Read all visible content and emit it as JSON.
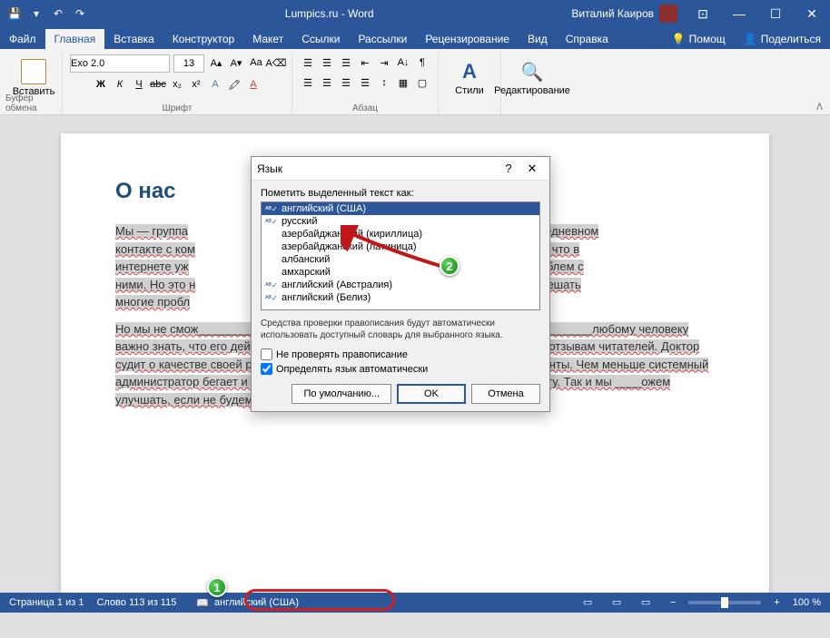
{
  "app": {
    "title": "Lumpics.ru - Word",
    "user": "Виталий Каиров"
  },
  "tabs": {
    "file": "Файл",
    "home": "Главная",
    "insert": "Вставка",
    "design": "Конструктор",
    "layout": "Макет",
    "references": "Ссылки",
    "mailings": "Рассылки",
    "review": "Рецензирование",
    "view": "Вид",
    "help": "Справка",
    "tell_me": "Помощ",
    "share": "Поделиться"
  },
  "ribbon": {
    "paste": "Вставить",
    "clipboard_group": "Буфер обмена",
    "font_name": "Exo 2.0",
    "font_size": "13",
    "font_group": "Шрифт",
    "paragraph_group": "Абзац",
    "styles": "Стили",
    "editing": "Редактирование"
  },
  "document": {
    "heading": "О нас",
    "p1a": "Мы — группа",
    "p1b": "м в ежедневном",
    "p2a": "контакте с ком",
    "p2b": "Мы знаем, что в",
    "p3a": "интернете уж",
    "p3b": "да проблем с",
    "p4a": "ними. Но это н",
    "p4b": "Вам, как решать",
    "p5": "многие пробл",
    "p6": "Но мы не смож____________________________________________________________любому человеку важно знать, что его действия правильные. Писатель судит о своей работе по отзывам читателей. Доктор судит о качестве своей работы по тому, как быстро выздоравливают его пациенты. Чем меньше системный администратор бегает и что-то настраивает, тем он качественнее делает работу. Так и мы ____ожем улучшать, если не будем получать ответов от Вас."
  },
  "dialog": {
    "title": "Язык",
    "label": "Пометить выделенный текст как:",
    "items": [
      "английский (США)",
      "русский",
      "азербайджанский (кириллица)",
      "азербайджанский (латиница)",
      "албанский",
      "амхарский",
      "английский (Австралия)",
      "английский (Белиз)"
    ],
    "info": "Средства проверки правописания будут автоматически использовать доступный словарь для выбранного языка.",
    "chk1": "Не проверять правописание",
    "chk2": "Определять язык автоматически",
    "default_btn": "По умолчанию...",
    "ok": "OK",
    "cancel": "Отмена"
  },
  "statusbar": {
    "page": "Страница 1 из 1",
    "words": "Слово 113 из 115",
    "language": "английский (США)",
    "zoom": "100 %"
  },
  "markers": {
    "m1": "1",
    "m2": "2"
  }
}
